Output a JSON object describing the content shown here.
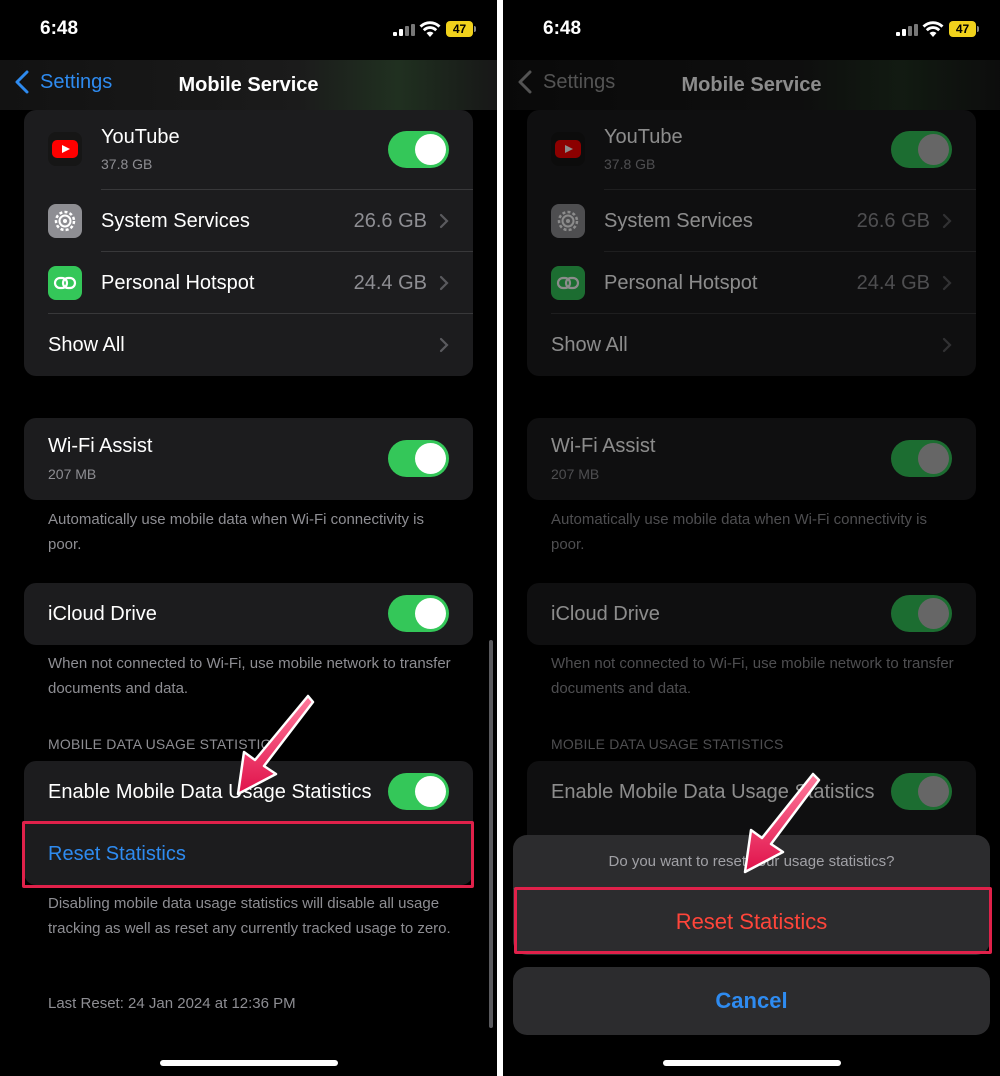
{
  "status": {
    "time": "6:48",
    "battery": "47"
  },
  "nav": {
    "back_label": "Settings",
    "title": "Mobile Service"
  },
  "apps": [
    {
      "name": "YouTube",
      "usage": "37.8 GB",
      "toggle_on": true
    },
    {
      "name": "System Services",
      "value": "26.6 GB"
    },
    {
      "name": "Personal Hotspot",
      "value": "24.4 GB"
    }
  ],
  "show_all": "Show All",
  "wifi_assist": {
    "title": "Wi-Fi Assist",
    "usage": "207 MB",
    "footer": "Automatically use mobile data when Wi-Fi connectivity is poor."
  },
  "icloud_drive": {
    "title": "iCloud Drive",
    "footer": "When not connected to Wi-Fi, use mobile network to transfer documents and data."
  },
  "usage_stats": {
    "header": "MOBILE DATA USAGE STATISTICS",
    "enable_label": "Enable Mobile Data Usage Statistics",
    "reset_label": "Reset Statistics",
    "footer": "Disabling mobile data usage statistics will disable all usage tracking as well as reset any currently tracked usage to zero.",
    "last_reset": "Last Reset: 24 Jan 2024 at 12:36 PM"
  },
  "action_sheet": {
    "message": "Do you want to reset your usage statistics?",
    "reset_label": "Reset Statistics",
    "cancel_label": "Cancel"
  },
  "colors": {
    "accent": "#2e8bf0",
    "toggle_on": "#34c759",
    "destructive": "#ff453a",
    "highlight": "#e0214a",
    "background": "#000000",
    "group": "#1c1c1e"
  },
  "icons": [
    "youtube-icon",
    "gear-icon",
    "link-icon",
    "chevron-right-icon",
    "chevron-left-icon",
    "wifi-icon",
    "signal-icon",
    "battery-icon",
    "arrow-annotation"
  ]
}
